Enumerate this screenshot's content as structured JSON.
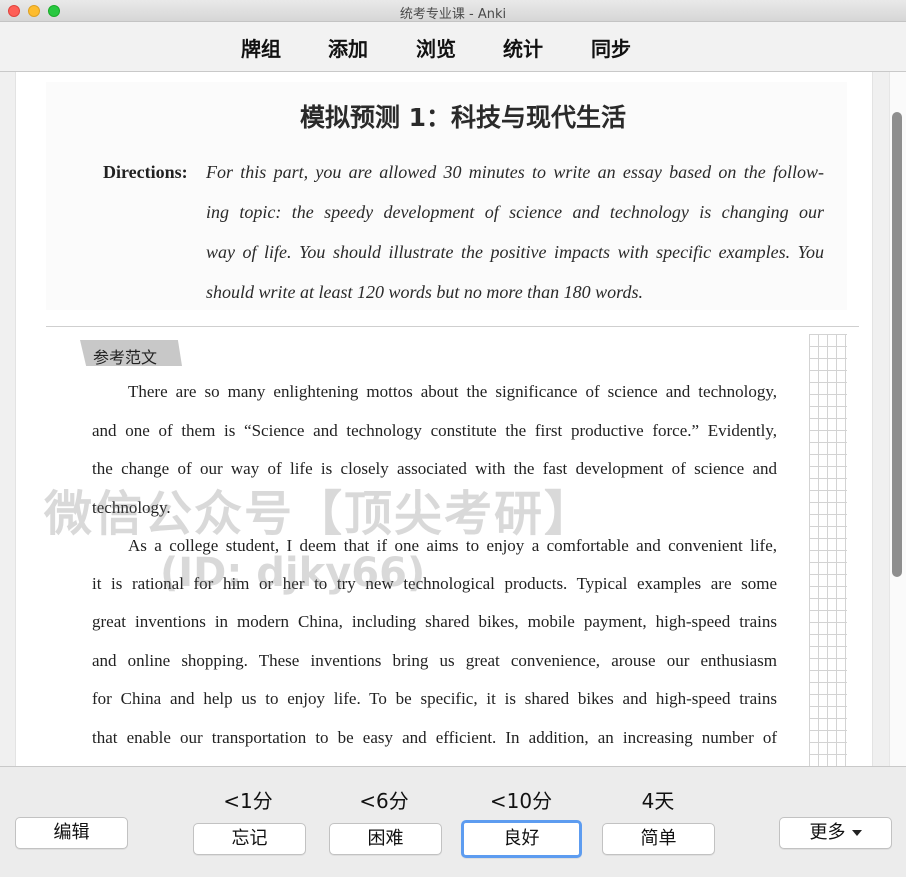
{
  "window": {
    "title": "统考专业课 - Anki"
  },
  "topnav": {
    "items": [
      "牌组",
      "添加",
      "浏览",
      "统计",
      "同步"
    ]
  },
  "card": {
    "heading": "模拟预测 1：科技与现代生活",
    "directions_label": "Directions:",
    "directions_lines": [
      "For this part, you are allowed 30 minutes to write an essay based on the follow-",
      "ing topic: the speedy development of science and technology is changing our",
      "way of life. You should illustrate the positive impacts with specific examples. You",
      "should write at least 120 words but no more than 180 words."
    ],
    "tag": "参考范文",
    "paragraph_lines": [
      "There are so many enlightening mottos about the significance of science and technology,",
      "and one of them is “Science and technology constitute the first productive force.” Evidently,",
      "the change of our way of life is closely associated with the fast development of science and",
      "technology.",
      "As a college student, I deem that if one aims to enjoy a comfortable and convenient life,",
      "it is rational for him or her to try new technological products. Typical examples are some",
      "great inventions in modern China, including shared bikes, mobile payment, high-speed trains",
      "and online shopping. These inventions bring us great convenience, arouse our enthusiasm",
      "for China and help us to enjoy life. To be specific, it is shared bikes and high-speed trains",
      "that enable our transportation to be easy and efficient. In addition, an increasing number of"
    ],
    "watermark_line1": "微信公众号【顶尖考研】",
    "watermark_line2": "(ID: djky66)"
  },
  "bottom": {
    "edit": "编辑",
    "more": "更多",
    "intervals": [
      "<1分",
      "<6分",
      "<10分",
      "4天"
    ],
    "answers": [
      "忘记",
      "困难",
      "良好",
      "简单"
    ]
  }
}
